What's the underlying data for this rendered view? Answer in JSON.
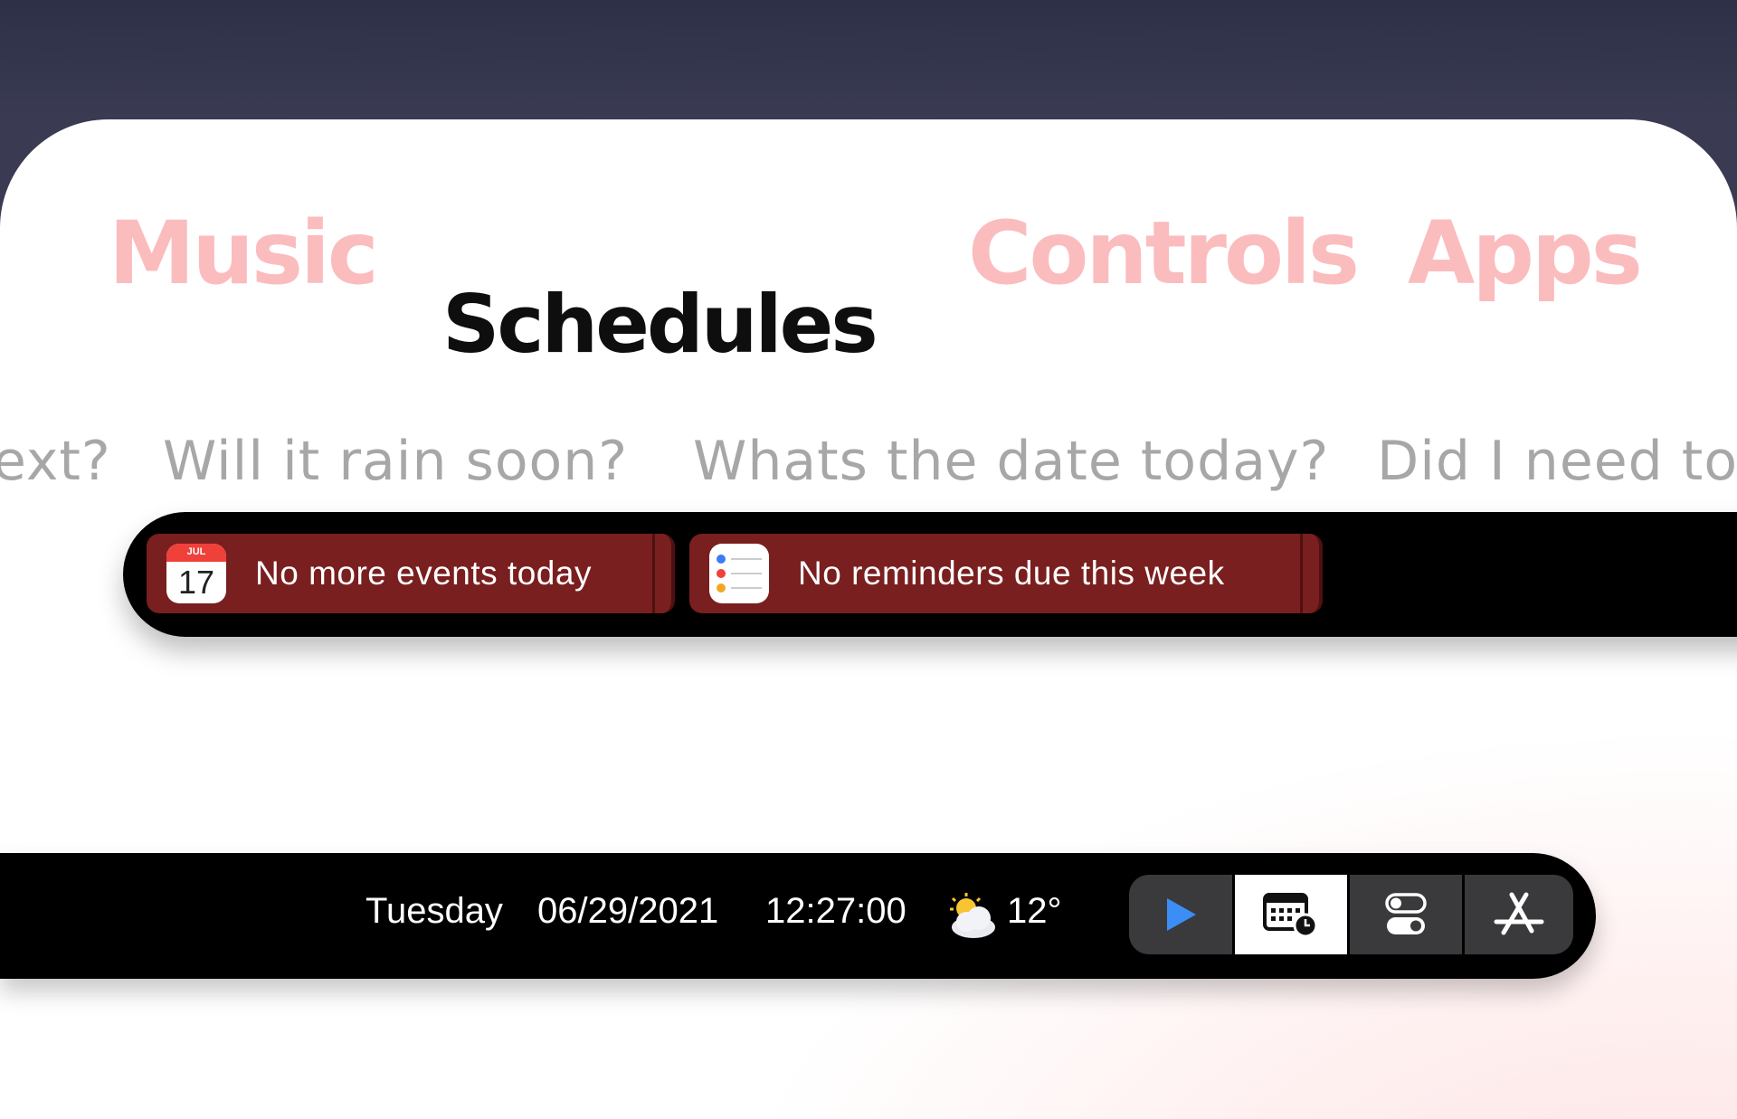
{
  "tabs": [
    {
      "label": "Music",
      "active": false
    },
    {
      "label": "Schedules",
      "active": true
    },
    {
      "label": "Controls",
      "active": false
    },
    {
      "label": "Apps",
      "active": false
    }
  ],
  "prompts": [
    "ext?",
    "Will it rain soon?",
    "Whats the date today?",
    "Did I need to g"
  ],
  "widgets": {
    "calendar": {
      "icon": "calendar-icon",
      "month": "JUL",
      "day": "17",
      "label": "No more events today"
    },
    "reminders": {
      "icon": "reminders-icon",
      "label": "No reminders due this week"
    }
  },
  "status": {
    "day": "Tuesday",
    "date": "06/29/2021",
    "time": "12:27:00",
    "weather_icon": "partly-cloudy-icon",
    "temperature": "12°"
  },
  "dock": [
    {
      "icon": "play-icon",
      "name": "Music",
      "active": false
    },
    {
      "icon": "calendar-clock-icon",
      "name": "Schedules",
      "active": true
    },
    {
      "icon": "toggles-icon",
      "name": "Controls",
      "active": false
    },
    {
      "icon": "app-store-icon",
      "name": "Apps",
      "active": false
    }
  ],
  "colors": {
    "inactive_tab": "#fbbcbe",
    "active_tab": "#0e0e0e",
    "chip_background": "#7a1f1f",
    "play_blue": "#3a8ef6"
  }
}
